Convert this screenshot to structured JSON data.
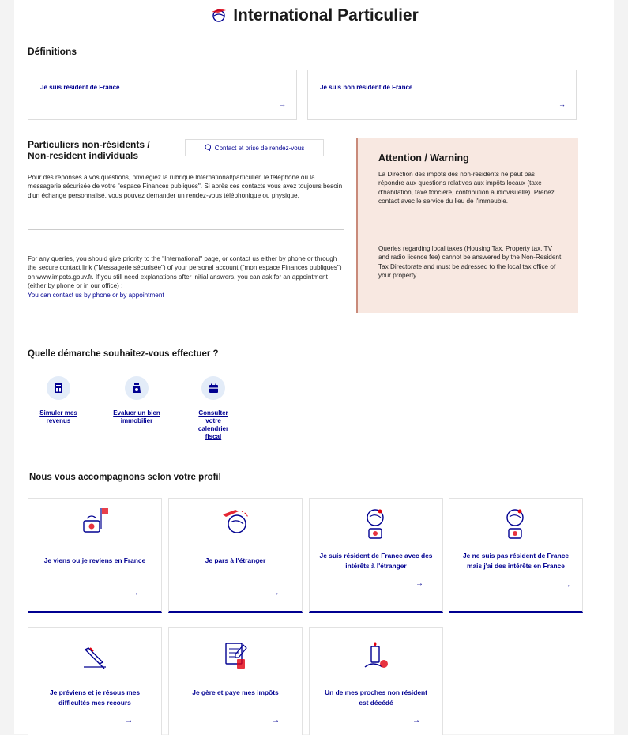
{
  "title": "International Particulier",
  "definitions": {
    "heading": "Définitions",
    "resident": "Je suis résident de France",
    "nonresident": "Je suis non résident de France",
    "arrow": "→"
  },
  "nonresident": {
    "title_line1": "Particuliers non-résidents /",
    "title_line2": "Non-resident individuals",
    "contact_label": "Contact et prise de rendez-vous",
    "fr_text": "Pour des réponses à vos questions, privilégiez la rubrique International/particulier, le téléphone ou la messagerie sécurisée de votre \"espace Finances publiques\". Si après ces contacts vous avez toujours besoin d'un échange personnalisé, vous pouvez demander un rendez-vous téléphonique ou physique.",
    "en_text": "For any queries, you should give priority to the \"International\" page, or contact us either by phone or through the secure contact link (\"Messagerie sécurisée\") of your personal account (\"mon espace Finances publiques\") on www.impots.gouv.fr. If you still need explanations after initial answers, you can ask for an appointment (either by phone or in our office) :",
    "en_link": "You can contact us by phone or by appointment"
  },
  "warning": {
    "title": "Attention / Warning",
    "fr": "La Direction des impôts des non-résidents ne peut pas répondre aux questions relatives aux impôts locaux (taxe d'habitation, taxe foncière, contribution audiovisuelle). Prenez contact avec le service du lieu de l'immeuble.",
    "en": "Queries regarding local taxes (Housing Tax, Property tax, TV and radio licence fee) cannot be answered by the Non-Resident Tax Directorate and must be adressed to the local tax office of your property."
  },
  "demarche": {
    "heading": "Quelle démarche souhaitez-vous effectuer ?",
    "items": [
      {
        "label": "Simuler mes revenus",
        "icon": "calculator-icon"
      },
      {
        "label": "Evaluer un bien immobilier",
        "icon": "weight-icon"
      },
      {
        "label": "Consulter votre calendrier fiscal",
        "icon": "calendar-icon"
      }
    ]
  },
  "profil": {
    "heading": "Nous vous accompagnons selon votre profil",
    "cards": [
      {
        "label": "Je viens ou je reviens en France",
        "icon": "arrival-icon"
      },
      {
        "label": "Je pars à l'étranger",
        "icon": "plane-globe-icon"
      },
      {
        "label": "Je suis résident de France avec des intérêts à l'étranger",
        "icon": "globe-pin-icon"
      },
      {
        "label": "Je ne suis pas résident de France mais j'ai des intérêts en France",
        "icon": "globe-pin-icon"
      },
      {
        "label": "Je préviens et je résous mes difficultés mes recours",
        "icon": "pencil-ruler-icon"
      },
      {
        "label": "Je gère et paye mes impôts",
        "icon": "tax-document-icon"
      },
      {
        "label": "Un de mes proches non résident est décédé",
        "icon": "memorial-icon"
      }
    ]
  },
  "colors": {
    "accent": "#000091",
    "warning_bg": "#f8e8e1",
    "icon_red": "#e1000f"
  }
}
